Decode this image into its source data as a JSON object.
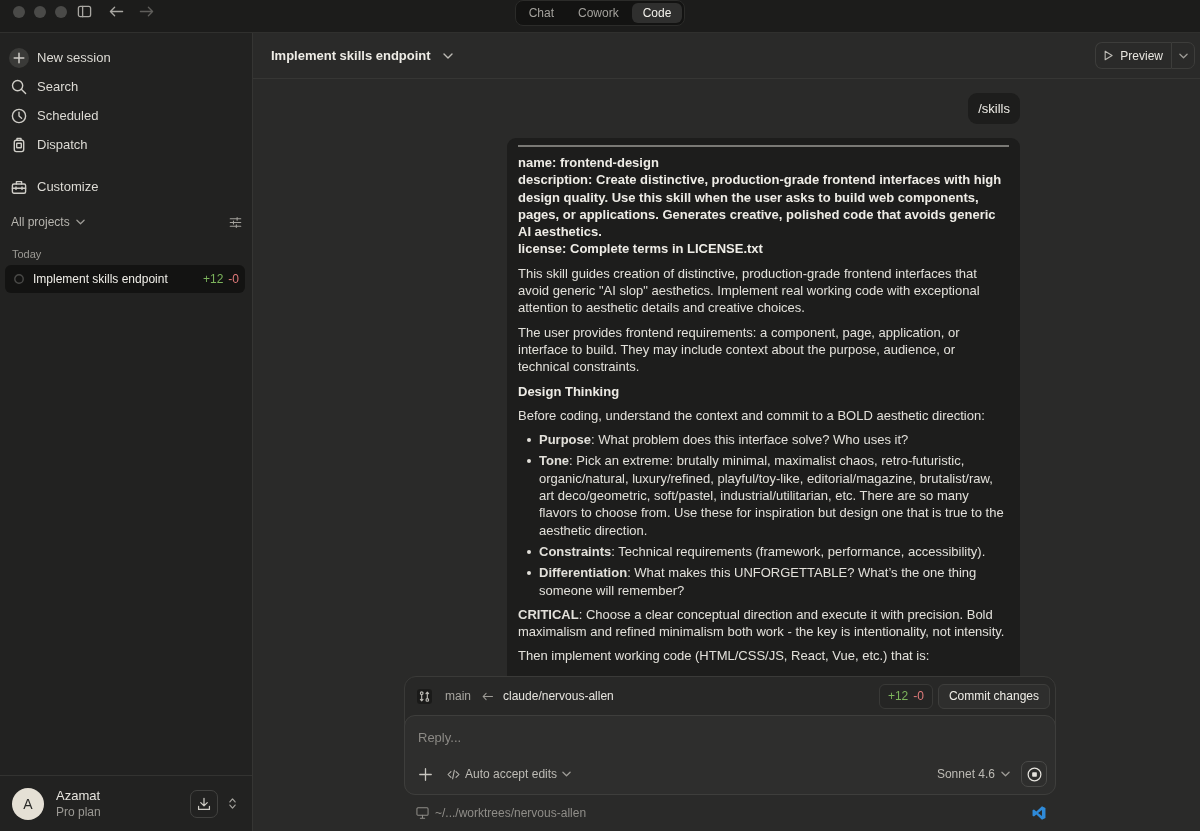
{
  "mode_tabs": [
    {
      "label": "Chat",
      "selected": false
    },
    {
      "label": "Cowork",
      "selected": false
    },
    {
      "label": "Code",
      "selected": true
    }
  ],
  "sidebar": {
    "nav": [
      {
        "label": "New session",
        "kind": "new"
      },
      {
        "label": "Search",
        "kind": "search"
      },
      {
        "label": "Scheduled",
        "kind": "scheduled"
      },
      {
        "label": "Dispatch",
        "kind": "dispatch"
      }
    ],
    "tools": [
      {
        "label": "Customize",
        "kind": "customize"
      }
    ],
    "project_filter": "All projects",
    "group_label": "Today",
    "sessions": [
      {
        "title": "Implement skills endpoint",
        "added": "+12",
        "removed": "-0",
        "selected": true
      }
    ],
    "user": {
      "initial": "A",
      "name": "Azamat",
      "plan": "Pro plan"
    }
  },
  "header": {
    "title": "Implement skills endpoint",
    "preview_button": "Preview"
  },
  "messages": [
    {
      "kind": "command",
      "text": "/skills"
    },
    {
      "kind": "document",
      "blocks": [
        {
          "kind": "rule"
        },
        {
          "kind": "frontmatter",
          "lines": [
            "name: frontend-design",
            "description: Create distinctive, production-grade frontend interfaces with high design quality. Use this skill when the user asks to build web components, pages, or applications. Generates creative, polished code that avoids generic AI aesthetics.",
            "license: Complete terms in LICENSE.txt"
          ]
        },
        {
          "kind": "paragraph",
          "text": "This skill guides creation of distinctive, production-grade frontend interfaces that avoid generic \"AI slop\" aesthetics. Implement real working code with exceptional attention to aesthetic details and creative choices."
        },
        {
          "kind": "paragraph",
          "text": "The user provides frontend requirements: a component, page, application, or interface to build. They may include context about the purpose, audience, or technical constraints."
        },
        {
          "kind": "heading",
          "text": "Design Thinking"
        },
        {
          "kind": "paragraph",
          "text": "Before coding, understand the context and commit to a BOLD aesthetic direction:"
        },
        {
          "kind": "list",
          "items": [
            "**Purpose**: What problem does this interface solve? Who uses it?",
            "**Tone**: Pick an extreme: brutally minimal, maximalist chaos, retro-futuristic, organic/natural, luxury/refined, playful/toy-like, editorial/magazine, brutalist/raw, art deco/geometric, soft/pastel, industrial/utilitarian, etc. There are so many flavors to choose from. Use these for inspiration but design one that is true to the aesthetic direction.",
            "**Constraints**: Technical requirements (framework, performance, accessibility).",
            "**Differentiation**: What makes this UNFORGETTABLE? What’s the one thing someone will remember?"
          ]
        },
        {
          "kind": "paragraph",
          "text": "**CRITICAL**: Choose a clear conceptual direction and execute it with precision. Bold maximalism and refined minimalism both work - the key is intentionality, not intensity."
        },
        {
          "kind": "paragraph",
          "text": "Then implement working code (HTML/CSS/JS, React, Vue, etc.) that is:"
        }
      ]
    }
  ],
  "composer": {
    "branch": {
      "base": "main",
      "head": "claude/nervous-allen"
    },
    "diff": {
      "added": "+12",
      "removed": "-0"
    },
    "commit_button": "Commit changes",
    "reply": {
      "placeholder": "Reply..."
    },
    "mode": "Auto accept edits",
    "model": "Sonnet 4.6"
  },
  "footer": {
    "path": "~/.../worktrees/nervous-allen"
  }
}
